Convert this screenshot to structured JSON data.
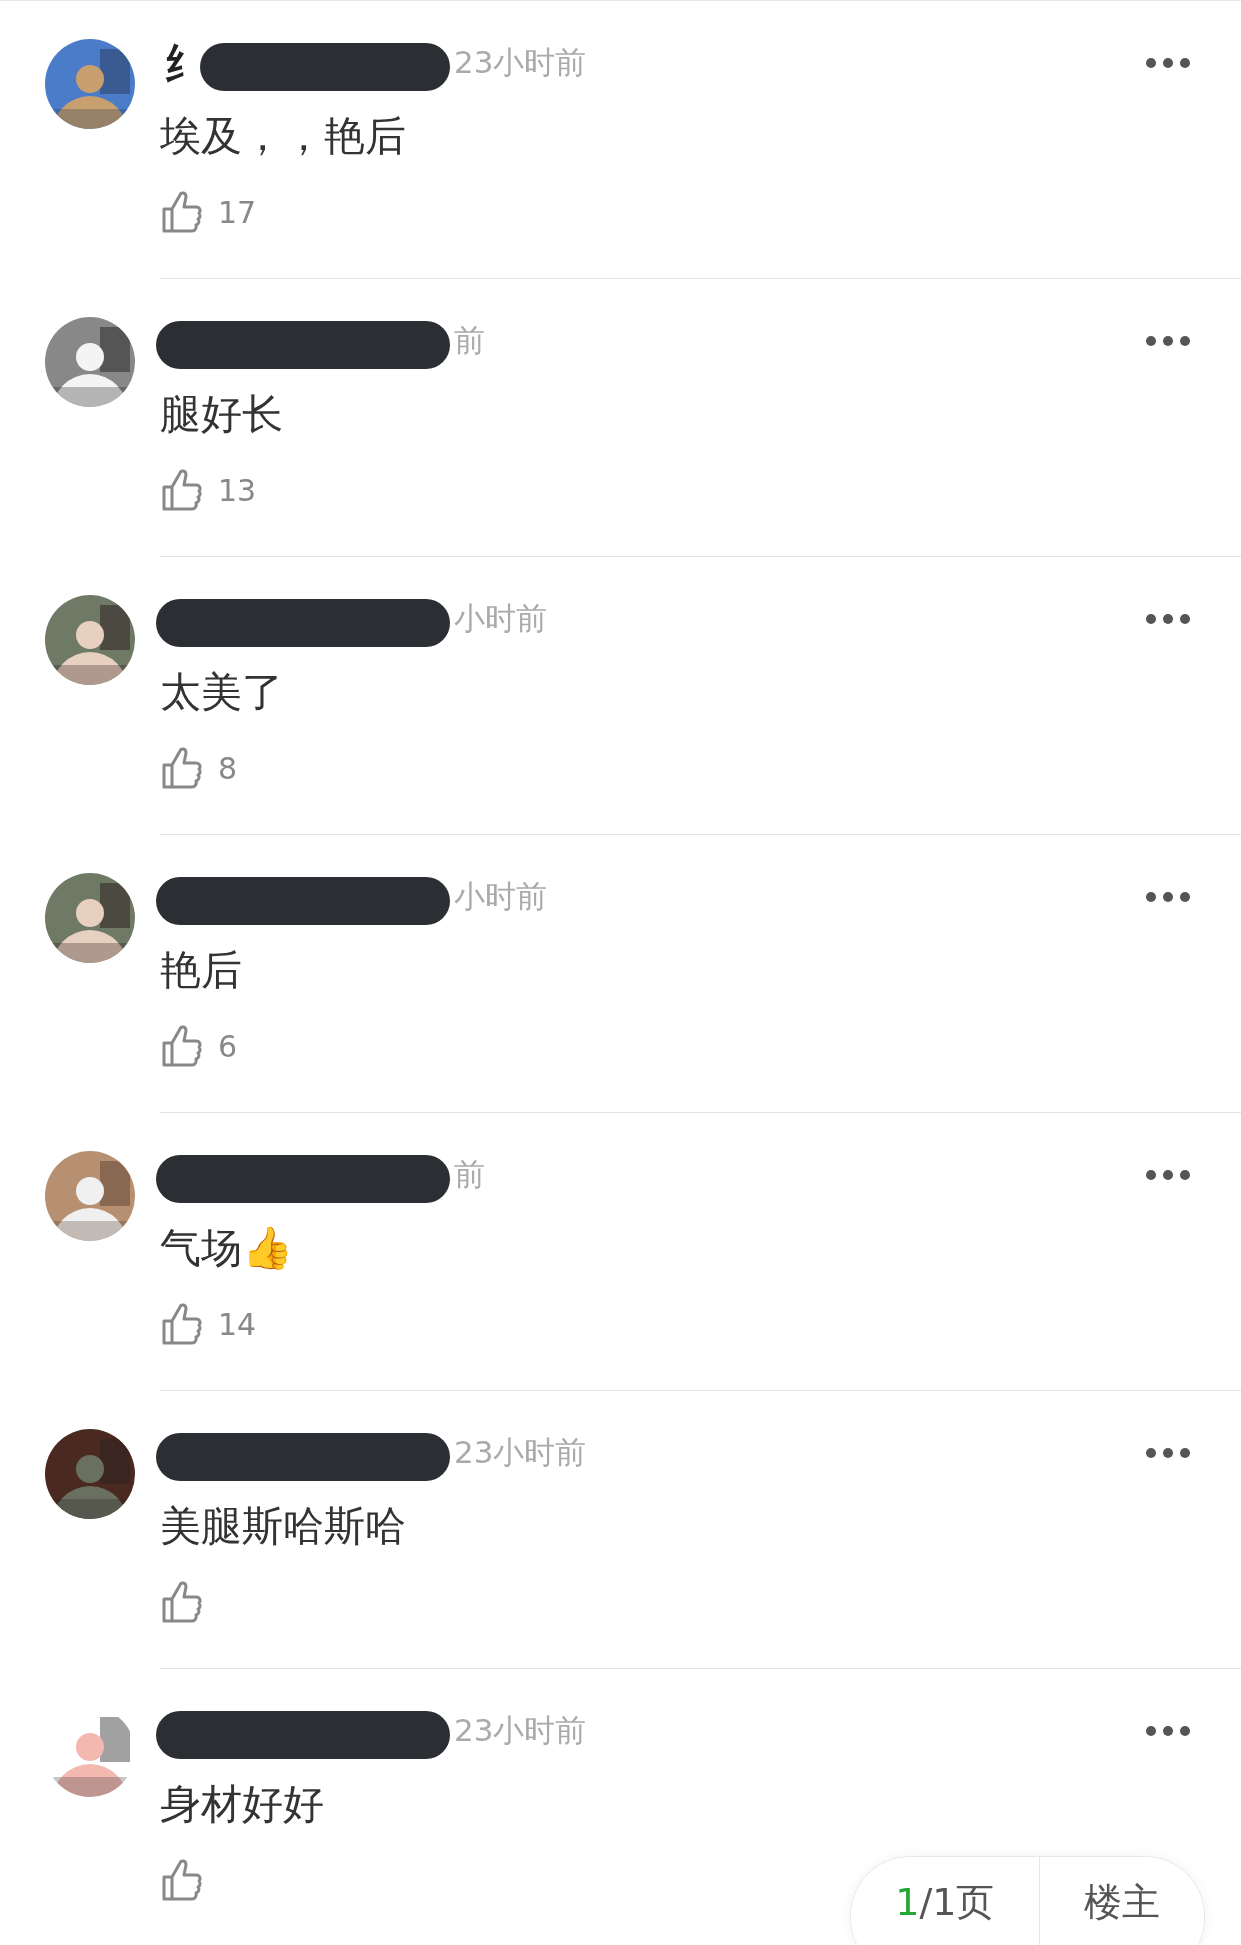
{
  "comments": [
    {
      "name_fragment": "纟",
      "name_redacted": true,
      "time": "23小时前",
      "text": "埃及，，艳后",
      "likes": "17"
    },
    {
      "name_redacted": true,
      "time": "前",
      "text": "腿好长",
      "likes": "13"
    },
    {
      "name_redacted": true,
      "time": "小时前",
      "text": "太美了",
      "likes": "8"
    },
    {
      "name_redacted": true,
      "time": "小时前",
      "text": "艳后",
      "likes": "6"
    },
    {
      "name_redacted": true,
      "time": "前",
      "text": "气场👍",
      "likes": "14"
    },
    {
      "name_redacted": true,
      "time": "23小时前",
      "text": "美腿斯哈斯哈"
    },
    {
      "name_redacted": true,
      "time": "23小时前",
      "text": "身材好好"
    }
  ],
  "pager": {
    "current": "1",
    "total": "/1页",
    "owner_button": "楼主"
  }
}
